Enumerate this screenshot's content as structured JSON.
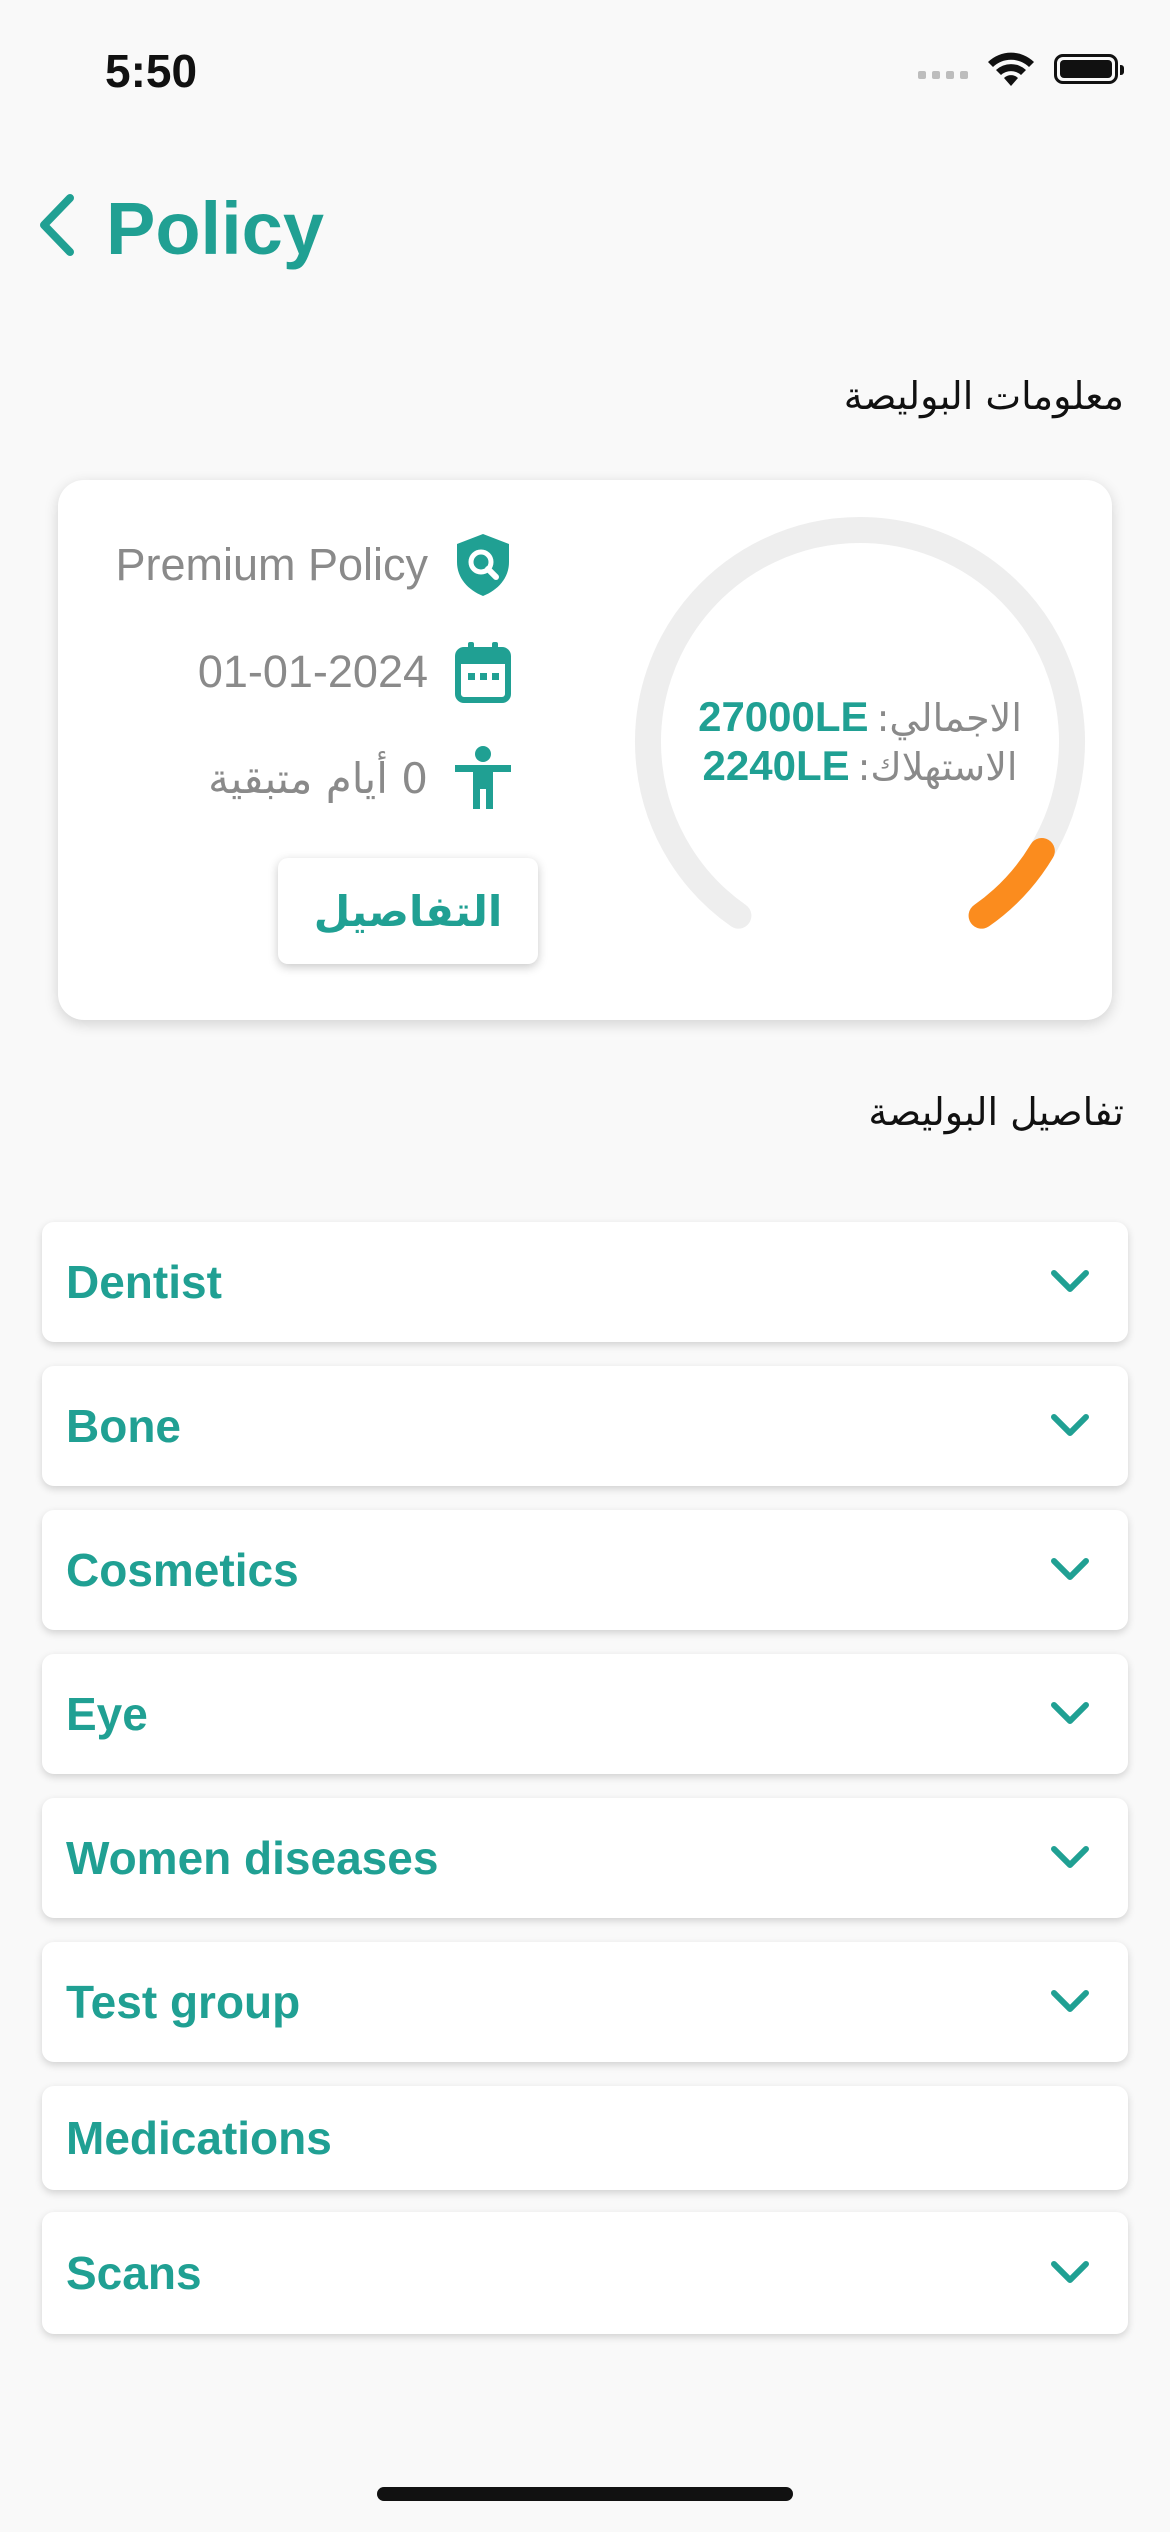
{
  "status_bar": {
    "time": "5:50"
  },
  "header": {
    "title": "Policy",
    "back_icon": "chevron-left-icon"
  },
  "policy_info": {
    "section_title": "معلومات البوليصة",
    "policy_name": "Premium Policy",
    "policy_icon": "shield-search-icon",
    "date": "01-01-2024",
    "date_icon": "calendar-icon",
    "days_remaining": "0 أيام متبقية",
    "person_icon": "person-icon",
    "details_button": "التفاصيل"
  },
  "usage_gauge": {
    "total_label": "الاجمالي:",
    "total_value": "27000LE",
    "consumption_label": "الاستهلاك:",
    "consumption_value": "2240LE",
    "total_amount": 27000,
    "consumed_amount": 2240,
    "track_color": "#eeeeee",
    "progress_color": "#fb8c1e"
  },
  "policy_details": {
    "section_title": "تفاصيل البوليصة",
    "items": [
      {
        "label": "Dentist",
        "expandable": true
      },
      {
        "label": "Bone",
        "expandable": true
      },
      {
        "label": "Cosmetics",
        "expandable": true
      },
      {
        "label": "Eye",
        "expandable": true
      },
      {
        "label": "Women diseases",
        "expandable": true
      },
      {
        "label": "Test group",
        "expandable": true
      },
      {
        "label": "Medications",
        "expandable": false
      },
      {
        "label": "Scans",
        "expandable": true
      }
    ]
  },
  "colors": {
    "accent": "#20a093",
    "background": "#f9f9f9",
    "muted_text": "#8a8a8a"
  }
}
